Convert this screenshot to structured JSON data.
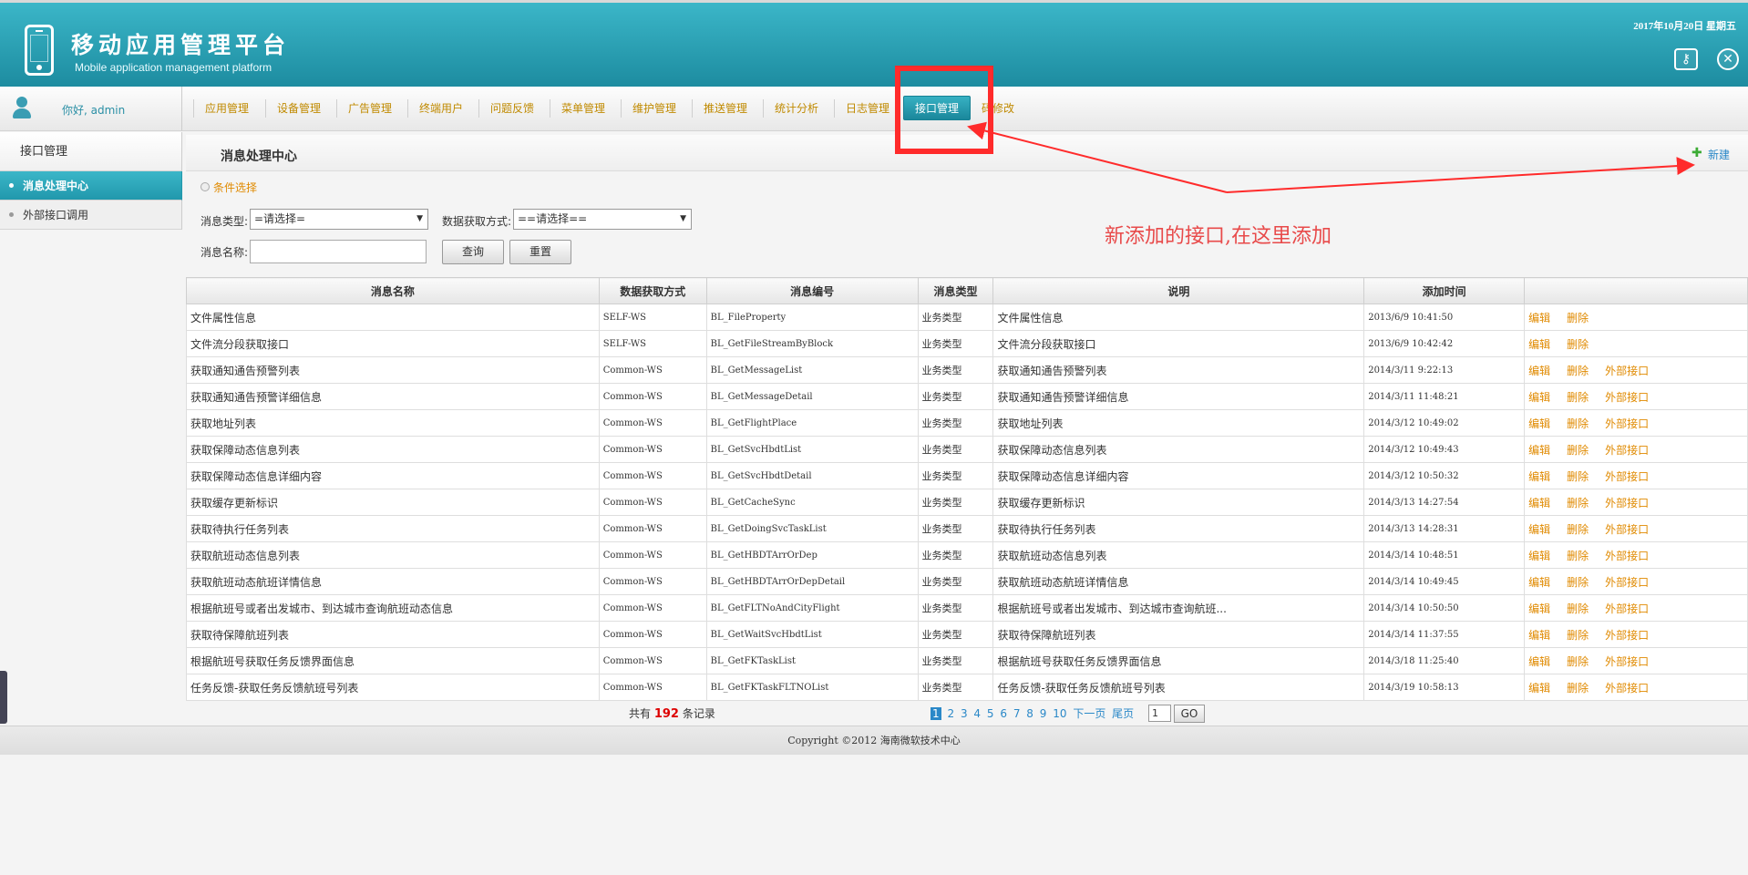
{
  "header": {
    "title": "移动应用管理平台",
    "subtitle": "Mobile application management platform",
    "date": "2017年10月20日 星期五",
    "icons": [
      "key-icon",
      "close-icon"
    ]
  },
  "user": {
    "greeting": "你好, admin"
  },
  "nav": {
    "items": [
      "应用管理",
      "设备管理",
      "广告管理",
      "终端用户",
      "问题反馈",
      "菜单管理",
      "维护管理",
      "推送管理",
      "统计分析",
      "日志管理",
      "接口管理",
      "密码修改"
    ],
    "active": "接口管理",
    "last_visible": "码修改"
  },
  "sidebar": {
    "title": "接口管理",
    "items": [
      "消息处理中心",
      "外部接口调用"
    ]
  },
  "main": {
    "title": "消息处理中心",
    "new_label": "新建",
    "condition_label": "条件选择",
    "filters": {
      "type_label": "消息类型:",
      "type_value": "=请选择=",
      "method_label": "数据获取方式:",
      "method_value": "==请选择==",
      "name_label": "消息名称:",
      "name_value": ""
    },
    "query_label": "查询",
    "reset_label": "重置"
  },
  "annotation": {
    "text": "新添加的接口,在这里添加",
    "color": "#e84a4a"
  },
  "table": {
    "headers": [
      "消息名称",
      "数据获取方式",
      "消息编号",
      "消息类型",
      "说明",
      "添加时间",
      ""
    ],
    "rows": [
      {
        "name": "文件属性信息",
        "method": "SELF-WS",
        "code": "BL_FileProperty",
        "type": "业务类型",
        "desc": "文件属性信息",
        "time": "2013/6/9 10:41:50",
        "ext": false
      },
      {
        "name": "文件流分段获取接口",
        "method": "SELF-WS",
        "code": "BL_GetFileStreamByBlock",
        "type": "业务类型",
        "desc": "文件流分段获取接口",
        "time": "2013/6/9 10:42:42",
        "ext": false
      },
      {
        "name": "获取通知通告预警列表",
        "method": "Common-WS",
        "code": "BL_GetMessageList",
        "type": "业务类型",
        "desc": "获取通知通告预警列表",
        "time": "2014/3/11 9:22:13",
        "ext": true
      },
      {
        "name": "获取通知通告预警详细信息",
        "method": "Common-WS",
        "code": "BL_GetMessageDetail",
        "type": "业务类型",
        "desc": "获取通知通告预警详细信息",
        "time": "2014/3/11 11:48:21",
        "ext": true
      },
      {
        "name": "获取地址列表",
        "method": "Common-WS",
        "code": "BL_GetFlightPlace",
        "type": "业务类型",
        "desc": "获取地址列表",
        "time": "2014/3/12 10:49:02",
        "ext": true
      },
      {
        "name": "获取保障动态信息列表",
        "method": "Common-WS",
        "code": "BL_GetSvcHbdtList",
        "type": "业务类型",
        "desc": "获取保障动态信息列表",
        "time": "2014/3/12 10:49:43",
        "ext": true
      },
      {
        "name": "获取保障动态信息详细内容",
        "method": "Common-WS",
        "code": "BL_GetSvcHbdtDetail",
        "type": "业务类型",
        "desc": "获取保障动态信息详细内容",
        "time": "2014/3/12 10:50:32",
        "ext": true
      },
      {
        "name": "获取缓存更新标识",
        "method": "Common-WS",
        "code": "BL_GetCacheSync",
        "type": "业务类型",
        "desc": "获取缓存更新标识",
        "time": "2014/3/13 14:27:54",
        "ext": true
      },
      {
        "name": "获取待执行任务列表",
        "method": "Common-WS",
        "code": "BL_GetDoingSvcTaskList",
        "type": "业务类型",
        "desc": "获取待执行任务列表",
        "time": "2014/3/13 14:28:31",
        "ext": true
      },
      {
        "name": "获取航班动态信息列表",
        "method": "Common-WS",
        "code": "BL_GetHBDTArrOrDep",
        "type": "业务类型",
        "desc": "获取航班动态信息列表",
        "time": "2014/3/14 10:48:51",
        "ext": true
      },
      {
        "name": "获取航班动态航班详情信息",
        "method": "Common-WS",
        "code": "BL_GetHBDTArrOrDepDetail",
        "type": "业务类型",
        "desc": "获取航班动态航班详情信息",
        "time": "2014/3/14 10:49:45",
        "ext": true
      },
      {
        "name": "根据航班号或者出发城市、到达城市查询航班动态信息",
        "method": "Common-WS",
        "code": "BL_GetFLTNoAndCityFlight",
        "type": "业务类型",
        "desc": "根据航班号或者出发城市、到达城市查询航班...",
        "time": "2014/3/14 10:50:50",
        "ext": true
      },
      {
        "name": "获取待保障航班列表",
        "method": "Common-WS",
        "code": "BL_GetWaitSvcHbdtList",
        "type": "业务类型",
        "desc": "获取待保障航班列表",
        "time": "2014/3/14 11:37:55",
        "ext": true
      },
      {
        "name": "根据航班号获取任务反馈界面信息",
        "method": "Common-WS",
        "code": "BL_GetFKTaskList",
        "type": "业务类型",
        "desc": "根据航班号获取任务反馈界面信息",
        "time": "2014/3/18 11:25:40",
        "ext": true
      },
      {
        "name": "任务反馈-获取任务反馈航班号列表",
        "method": "Common-WS",
        "code": "BL_GetFKTaskFLTNOList",
        "type": "业务类型",
        "desc": "任务反馈-获取任务反馈航班号列表",
        "time": "2014/3/19 10:58:13",
        "ext": true
      }
    ],
    "ops": {
      "edit": "编辑",
      "delete": "删除",
      "external": "外部接口"
    }
  },
  "pager": {
    "prefix": "共有",
    "count": "192",
    "suffix": "条记录",
    "pages": [
      "1",
      "2",
      "3",
      "4",
      "5",
      "6",
      "7",
      "8",
      "9",
      "10"
    ],
    "next": "下一页",
    "last": "尾页",
    "input_value": "1",
    "go": "GO"
  },
  "footer": {
    "text": "Copyright ©2012 海南微软技术中心"
  }
}
